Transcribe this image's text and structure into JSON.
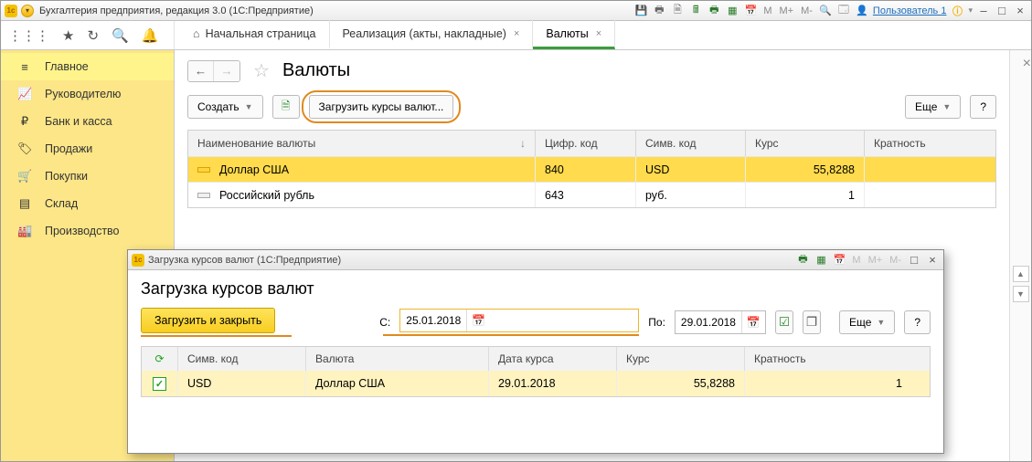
{
  "titlebar": {
    "title": "Бухгалтерия предприятия, редакция 3.0  (1С:Предприятие)",
    "m": "M",
    "mplus": "M+",
    "mminus": "M-",
    "user_label": "Пользователь 1"
  },
  "tabs": {
    "home": "Начальная страница",
    "t1": "Реализация (акты, накладные)",
    "t2": "Валюты"
  },
  "sidebar": {
    "items": [
      {
        "label": "Главное"
      },
      {
        "label": "Руководителю"
      },
      {
        "label": "Банк и касса"
      },
      {
        "label": "Продажи"
      },
      {
        "label": "Покупки"
      },
      {
        "label": "Склад"
      },
      {
        "label": "Производство"
      }
    ]
  },
  "page": {
    "title": "Валюты",
    "create": "Создать",
    "load_rates": "Загрузить курсы валют...",
    "more": "Еще",
    "help": "?"
  },
  "cols": {
    "name": "Наименование валюты",
    "numcode": "Цифр. код",
    "symcode": "Симв. код",
    "rate": "Курс",
    "mult": "Кратность"
  },
  "rows": [
    {
      "name": "Доллар США",
      "num": "840",
      "sym": "USD",
      "rate": "55,8288",
      "mult": ""
    },
    {
      "name": "Российский рубль",
      "num": "643",
      "sym": "руб.",
      "rate": "1",
      "mult": ""
    }
  ],
  "dlg": {
    "wintitle": "Загрузка курсов валют  (1С:Предприятие)",
    "title": "Загрузка курсов валют",
    "primary": "Загрузить и закрыть",
    "from_lbl": "С:",
    "to_lbl": "По:",
    "from": "25.01.2018",
    "to": "29.01.2018",
    "more": "Еще",
    "help": "?",
    "m": "M",
    "mplus": "M+",
    "mminus": "M-",
    "cols": {
      "sym": "Симв. код",
      "cur": "Валюта",
      "date": "Дата курса",
      "rate": "Курс",
      "mult": "Кратность"
    },
    "row": {
      "sym": "USD",
      "cur": "Доллар США",
      "date": "29.01.2018",
      "rate": "55,8288",
      "mult": "1"
    }
  }
}
